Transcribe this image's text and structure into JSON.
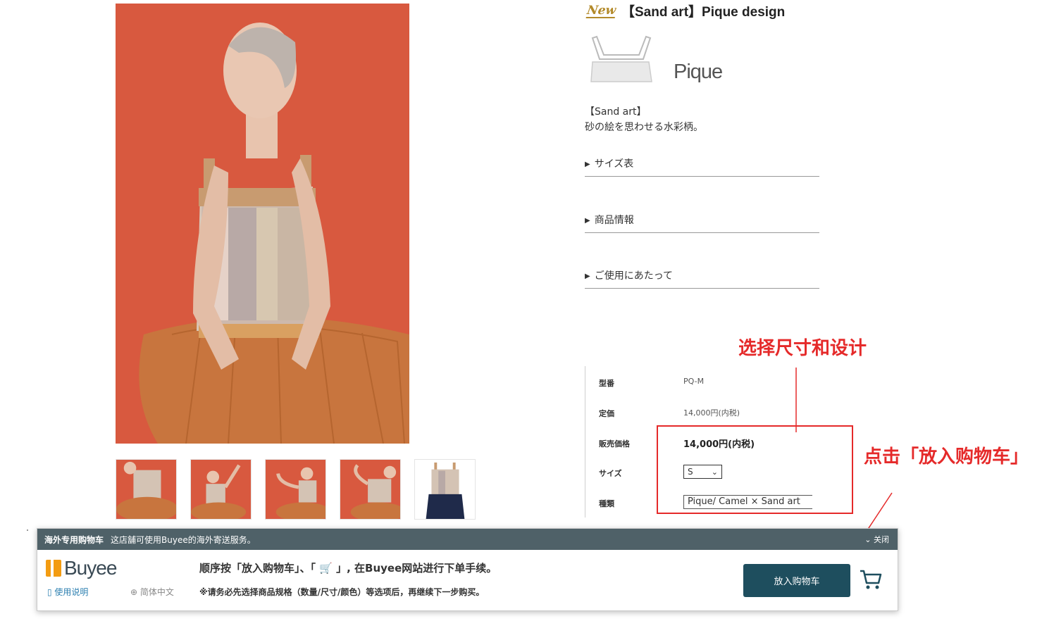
{
  "product": {
    "new_badge": "New",
    "title": "【Sand art】Pique design",
    "style_name": "Pique",
    "desc_line1": "【Sand art】",
    "desc_line2": "砂の絵を思わせる水彩柄。"
  },
  "accordions": [
    "サイズ表",
    "商品情報",
    "ご使用にあたって"
  ],
  "spec": {
    "model_label": "型番",
    "model_value": "PQ-M",
    "list_price_label": "定価",
    "list_price_value": "14,000円(内税)",
    "sale_price_label": "販売価格",
    "sale_price_value": "14,000円(内税)",
    "size_label": "サイズ",
    "size_value": "S",
    "type_label": "種類",
    "type_value": "Pique/ Camel × Sand art"
  },
  "annotations": {
    "select": "选择尺寸和设计",
    "click": "点击「放入购物车」"
  },
  "buyee": {
    "header_title": "海外专用购物车",
    "header_text": "这店舗可使用Buyee的海外寄送服务。",
    "close": "关闭",
    "logo": "Buyee",
    "guide": "使用说明",
    "lang": "简体中文",
    "line1": "顺序按「放入购物车」、「 🛒 」, 在Buyee网站进行下单手续。",
    "line2": "※请务必先选择商品规格（数量/尺寸/颜色）等选项后，再继续下一步购买。",
    "add_to_cart": "放入购物车"
  },
  "colors": {
    "backdrop": "#d8593f",
    "annotation_red": "#e52a2a",
    "buyee_header": "#4f6168",
    "cart_button": "#1e4e5e"
  }
}
